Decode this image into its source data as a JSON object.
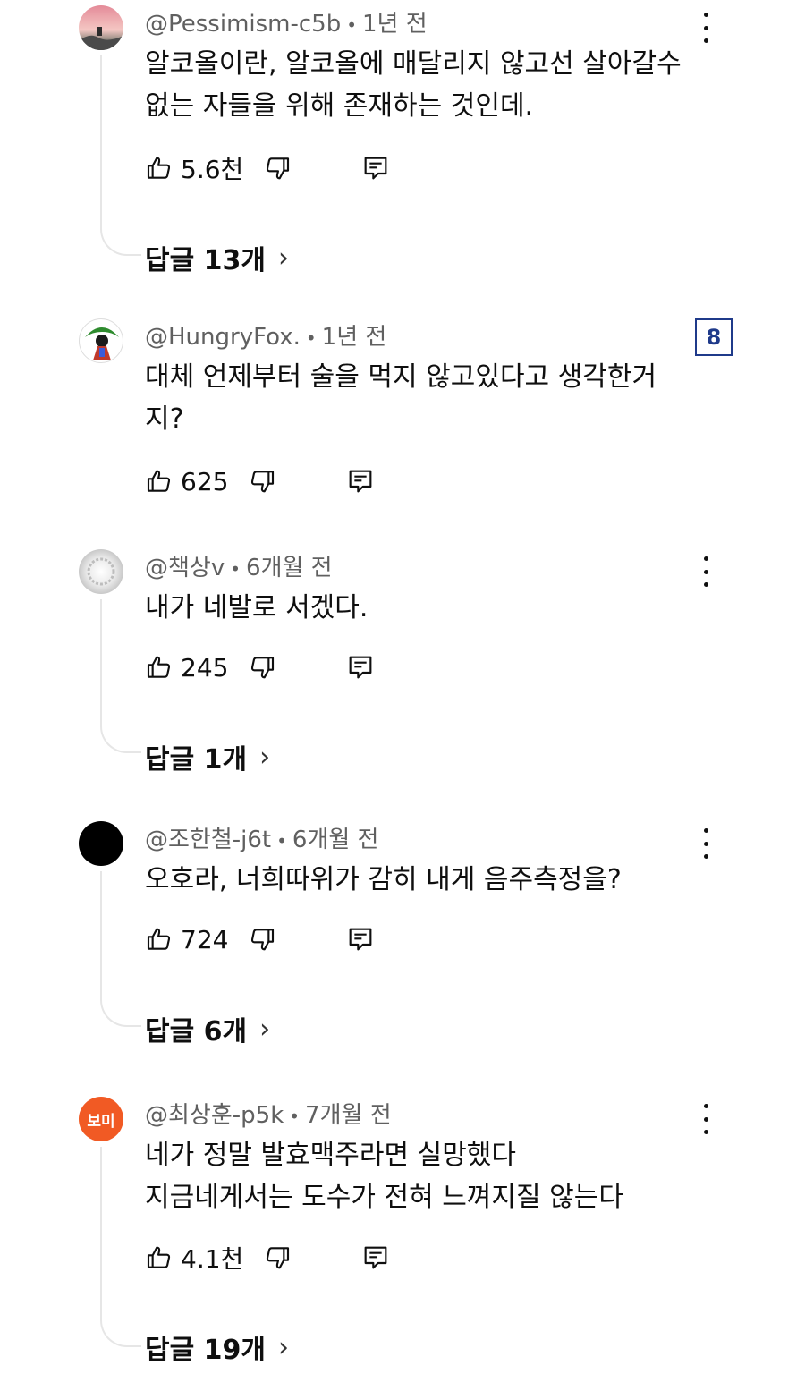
{
  "comments": [
    {
      "handle": "@Pessimism-c5b",
      "time": "1년 전",
      "text": "알코올이란, 알코올에 매달리지 않고선 살아갈수\n없는 자들을 위해 존재하는 것인데.",
      "likes": "5.6천",
      "replies": "답글 13개"
    },
    {
      "handle": "@HungryFox.",
      "time": "1년 전",
      "text": "대체 언제부터 술을 먹지 않고있다고 생각한거\n지?",
      "likes": "625",
      "badge": "8"
    },
    {
      "handle": "@책상v",
      "time": "6개월 전",
      "text": "내가 네발로 서겠다.",
      "likes": "245",
      "replies": "답글 1개"
    },
    {
      "handle": "@조한철-j6t",
      "time": "6개월 전",
      "text": "오호라, 너희따위가 감히 내게 음주측정을?",
      "likes": "724",
      "replies": "답글 6개"
    },
    {
      "handle": "@최상훈-p5k",
      "time": "7개월 전",
      "text": "네가 정말 발효맥주라면 실망했다\n지금네게서는 도수가 전혀 느껴지질 않는다",
      "likes": "4.1천",
      "replies": "답글 19개",
      "avatar_text": "보미"
    }
  ],
  "ui": {
    "separator": "•",
    "chevron": "›"
  },
  "colors": {
    "accent_badge": "#1f3a8a",
    "avatar_orange": "#f15a24",
    "meta_gray": "#606060"
  },
  "icons": [
    "thumbs-up-icon",
    "thumbs-down-icon",
    "reply-icon",
    "more-vert-icon",
    "chevron-right-icon"
  ]
}
